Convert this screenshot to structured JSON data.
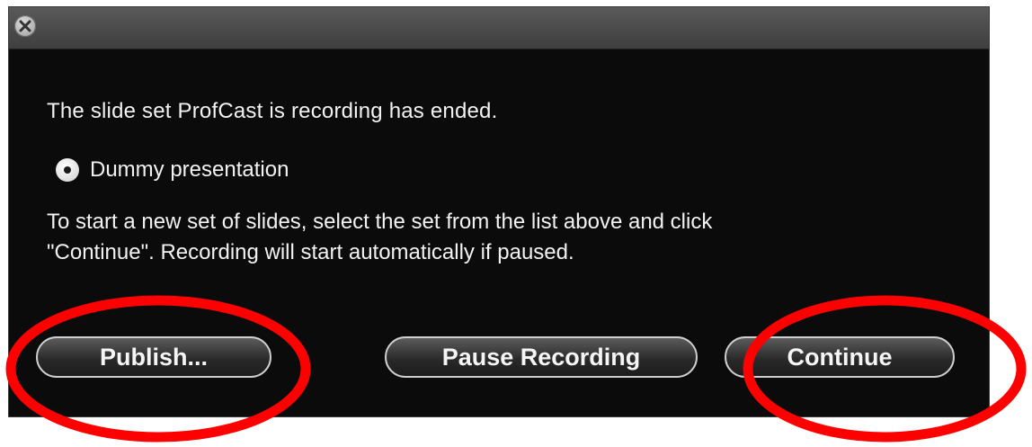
{
  "dialog": {
    "close_icon": "close-icon",
    "message": "The slide set ProfCast is recording has ended.",
    "presentation_option": {
      "label": "Dummy presentation",
      "selected": true
    },
    "instructions_line1": "To start a new set of slides, select the set from the list above and click",
    "instructions_line2": "\"Continue\". Recording will start automatically if paused.",
    "buttons": {
      "publish": "Publish...",
      "pause": "Pause Recording",
      "continue": "Continue"
    }
  },
  "annotation_color": "#ff0000"
}
